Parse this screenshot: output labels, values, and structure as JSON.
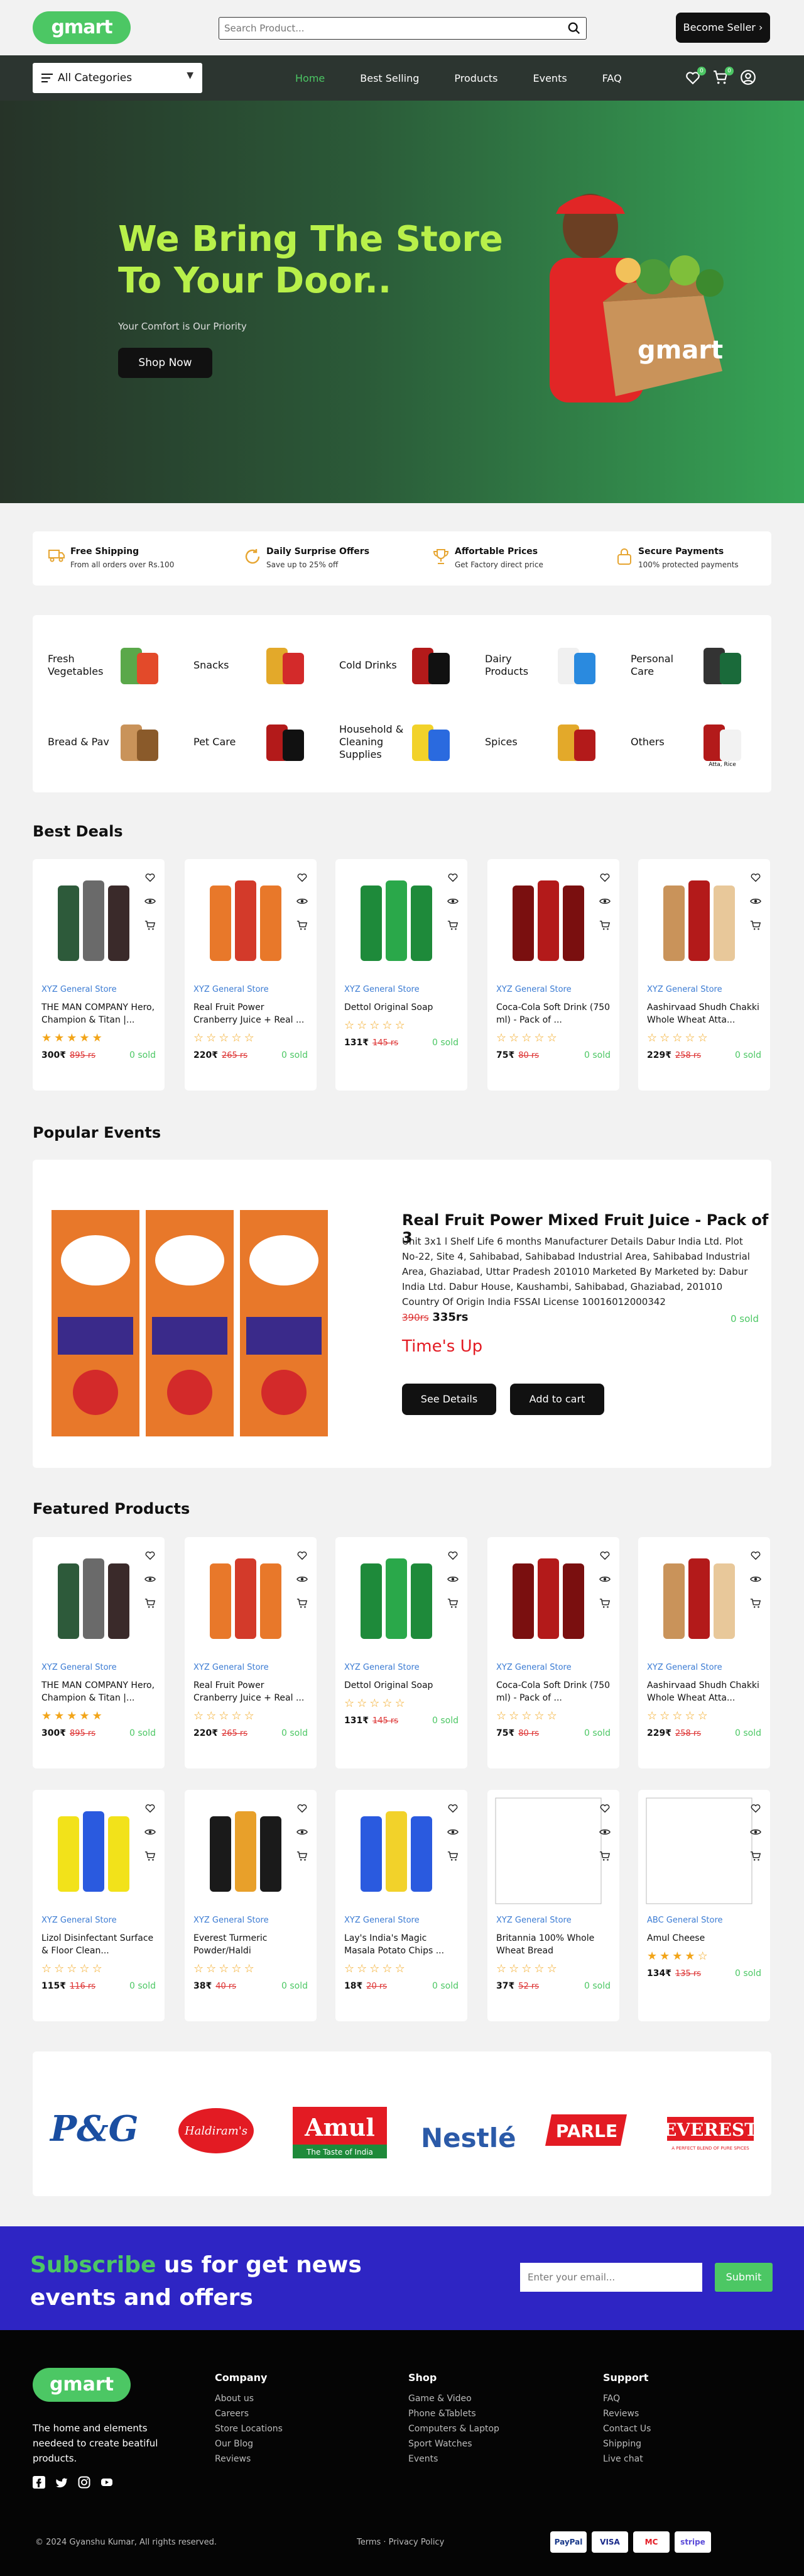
{
  "header": {
    "logo": "gmart",
    "search_placeholder": "Search Product...",
    "seller_button": "Become Seller",
    "seller_arrow": "›"
  },
  "nav": {
    "category_select": "All Categories",
    "links": [
      "Home",
      "Best Selling",
      "Products",
      "Events",
      "FAQ"
    ],
    "cart_count": "0",
    "wishlist_count": "0"
  },
  "hero": {
    "title": "We Bring The Store To Your Door..",
    "subtitle": "Your Comfort is Our Priority",
    "button": "Shop Now",
    "box_logo": "gmart"
  },
  "features": [
    {
      "title": "Free Shipping",
      "desc": "From all orders over Rs.100"
    },
    {
      "title": "Daily Surprise Offers",
      "desc": "Save up to 25% off"
    },
    {
      "title": "Affortable Prices",
      "desc": "Get Factory direct price"
    },
    {
      "title": "Secure Payments",
      "desc": "100% protected payments"
    }
  ],
  "categories": [
    {
      "name": "Fresh Vegetables"
    },
    {
      "name": "Snacks"
    },
    {
      "name": "Cold Drinks"
    },
    {
      "name": "Dairy Products"
    },
    {
      "name": "Personal Care"
    },
    {
      "name": "Bread & Pav"
    },
    {
      "name": "Pet Care"
    },
    {
      "name": "Household & Cleaning Supplies"
    },
    {
      "name": "Spices"
    },
    {
      "name": "Others",
      "img_label": "Atta, Rice"
    }
  ],
  "best_deals": {
    "title": "Best Deals",
    "products": [
      {
        "store": "XYZ General Store",
        "title": "THE MAN COMPANY Hero, Champion & Titan |...",
        "rating": 5,
        "price": "300₹",
        "old": "895 rs",
        "sold": "0 sold"
      },
      {
        "store": "XYZ General Store",
        "title": "Real Fruit Power Cranberry Juice + Real ...",
        "rating": 0,
        "price": "220₹",
        "old": "265 rs",
        "sold": "0 sold"
      },
      {
        "store": "XYZ General Store",
        "title": "Dettol Original Soap",
        "rating": 0,
        "price": "131₹",
        "old": "145 rs",
        "sold": "0 sold"
      },
      {
        "store": "XYZ General Store",
        "title": "Coca-Cola Soft Drink (750 ml) - Pack of ...",
        "rating": 0,
        "price": "75₹",
        "old": "80 rs",
        "sold": "0 sold"
      },
      {
        "store": "XYZ General Store",
        "title": "Aashirvaad Shudh Chakki Whole Wheat Atta...",
        "rating": 0,
        "price": "229₹",
        "old": "258 rs",
        "sold": "0 sold"
      }
    ]
  },
  "events": {
    "section_title": "Popular Events",
    "product_title": "Real Fruit Power Mixed Fruit Juice - Pack of 3",
    "description": "Unit 3x1 l Shelf Life 6 months Manufacturer Details Dabur India Ltd. Plot No-22, Site 4, Sahibabad, Sahibabad Industrial Area, Sahibabad Industrial Area, Ghaziabad, Uttar Pradesh 201010 Marketed By Marketed by: Dabur India Ltd. Dabur House, Kaushambi, Sahibabad, Ghaziabad, 201010 Country Of Origin India FSSAI License 10016012000342",
    "old_price": "390rs",
    "price": "335rs",
    "sold": "0 sold",
    "countdown": "Time's Up",
    "see_details": "See Details",
    "add_to_cart": "Add to cart"
  },
  "featured": {
    "title": "Featured Products",
    "products": [
      {
        "store": "XYZ General Store",
        "title": "THE MAN COMPANY Hero, Champion & Titan |...",
        "rating": 5,
        "price": "300₹",
        "old": "895 rs",
        "sold": "0 sold"
      },
      {
        "store": "XYZ General Store",
        "title": "Real Fruit Power Cranberry Juice + Real ...",
        "rating": 0,
        "price": "220₹",
        "old": "265 rs",
        "sold": "0 sold"
      },
      {
        "store": "XYZ General Store",
        "title": "Dettol Original Soap",
        "rating": 0,
        "price": "131₹",
        "old": "145 rs",
        "sold": "0 sold"
      },
      {
        "store": "XYZ General Store",
        "title": "Coca-Cola Soft Drink (750 ml) - Pack of ...",
        "rating": 0,
        "price": "75₹",
        "old": "80 rs",
        "sold": "0 sold"
      },
      {
        "store": "XYZ General Store",
        "title": "Aashirvaad Shudh Chakki Whole Wheat Atta...",
        "rating": 0,
        "price": "229₹",
        "old": "258 rs",
        "sold": "0 sold"
      },
      {
        "store": "XYZ General Store",
        "title": "Lizol Disinfectant Surface & Floor Clean...",
        "rating": 0,
        "price": "115₹",
        "old": "116 rs",
        "sold": "0 sold"
      },
      {
        "store": "XYZ General Store",
        "title": "Everest Turmeric Powder/Haldi",
        "rating": 0,
        "price": "38₹",
        "old": "40 rs",
        "sold": "0 sold"
      },
      {
        "store": "XYZ General Store",
        "title": "Lay's India's Magic Masala Potato Chips ...",
        "rating": 0,
        "price": "18₹",
        "old": "20 rs",
        "sold": "0 sold"
      },
      {
        "store": "XYZ General Store",
        "title": "Britannia 100% Whole Wheat Bread",
        "rating": 0,
        "price": "37₹",
        "old": "52 rs",
        "sold": "0 sold"
      },
      {
        "store": "ABC General Store",
        "title": "Amul Cheese",
        "rating": 4,
        "price": "134₹",
        "old": "135 rs",
        "sold": "0 sold"
      }
    ]
  },
  "brands": [
    "P&G",
    "Haldiram's",
    "Amul",
    "The Taste of India",
    "Nestlé",
    "PARLE",
    "EVEREST",
    "A PERFECT BLEND OF PURE SPICES"
  ],
  "subscribe": {
    "title_highlight": "Subscribe",
    "title_rest": " us for get news events and offers",
    "placeholder": "Enter your email...",
    "button": "Submit"
  },
  "footer": {
    "logo": "gmart",
    "about": "The home and elements needeed to create beatiful products.",
    "columns": [
      {
        "title": "Company",
        "items": [
          "About us",
          "Careers",
          "Store Locations",
          "Our Blog",
          "Reviews"
        ]
      },
      {
        "title": "Shop",
        "items": [
          "Game & Video",
          "Phone &Tablets",
          "Computers & Laptop",
          "Sport Watches",
          "Events"
        ]
      },
      {
        "title": "Support",
        "items": [
          "FAQ",
          "Reviews",
          "Contact Us",
          "Shipping",
          "Live chat"
        ]
      }
    ],
    "copyright": "© 2024 Gyanshu Kumar, All rights reserved.",
    "terms": "Terms · Privacy Policy",
    "payments": [
      "PayPal",
      "VISA",
      "MC",
      "stripe"
    ]
  },
  "colors": {
    "accent": "#4cc764",
    "hero_title": "#b8f04a",
    "subscribe_bg": "#2e25c4",
    "sold": "#4cc764",
    "old_price": "#dd3333",
    "store": "#3b7bd3"
  }
}
